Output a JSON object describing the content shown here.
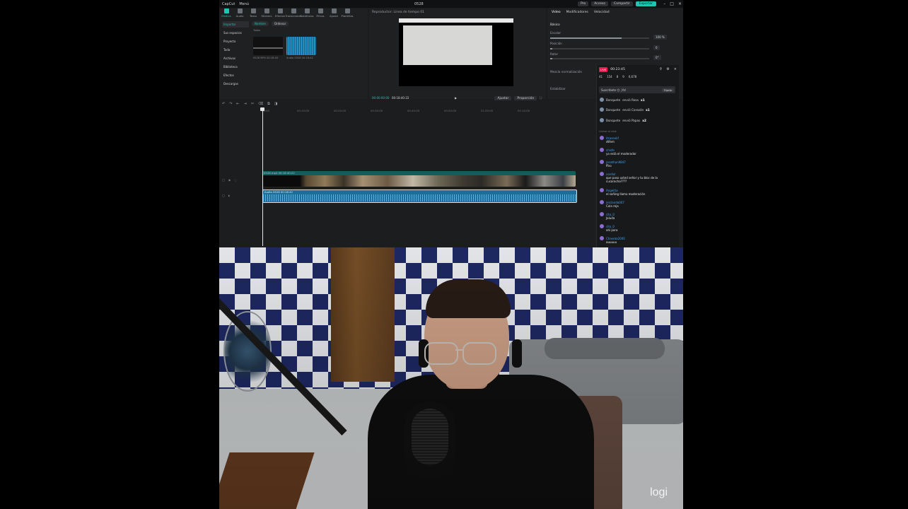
{
  "editor": {
    "menu": [
      "CapCut",
      "Menú"
    ],
    "window_title": "0528",
    "top_buttons": [
      "Pro",
      "Acceso",
      "Compartir"
    ],
    "export_label": "Exportar",
    "toolbar": [
      "Medios",
      "Audio",
      "Texto",
      "Stickers",
      "Efectos",
      "Transiciones",
      "Subtítulos",
      "Filtros",
      "Ajuste",
      "Plantillas"
    ],
    "media_sidebar": [
      "Importar",
      "Sus espacios",
      "Proyecto",
      "Toda",
      "Archivos",
      "Biblioteca",
      "Efectos",
      "Descargas"
    ],
    "media_filters": [
      "Nombre",
      "Ordenar"
    ],
    "media_label_folder": "Todos",
    "media_items": [
      {
        "caption": "0528 MP4 00:18:40"
      },
      {
        "caption": "Audio 0528 00:18:42"
      }
    ],
    "player": {
      "title": "Reproductor: Línea de tiempo 01",
      "timecode": "00:00:00:00",
      "duration": "00:18:40:22",
      "buttons": [
        "Ajustar",
        "Proporción"
      ]
    },
    "properties": {
      "tabs": [
        "Video",
        "Modificadores",
        "Velocidad"
      ],
      "section": "Básico",
      "rows": [
        {
          "label": "Escalar",
          "value": "100 %"
        },
        {
          "label": "Posición",
          "value": "0"
        },
        {
          "label": "Rotar",
          "value": "0°"
        }
      ],
      "option1": "Mezcla normalización",
      "option2": "Estabilizar"
    },
    "timeline": {
      "tools": [
        "↶",
        "↷",
        "⇤",
        "⇥",
        "✂",
        "⌫",
        "⧉",
        "◨"
      ],
      "ruler": [
        "00:00",
        "00:10:00",
        "00:20:00",
        "00:30:00",
        "00:40:00",
        "00:50:00",
        "01:00:00",
        "01:10:00"
      ],
      "video_clip_label": "0528.mp4  00:18:40:22",
      "audio_clip_label": "Audio 0528  00:18:42"
    }
  },
  "chat": {
    "live_badge": "LIVE",
    "elapsed": "00:23:45",
    "stats": [
      "41",
      "154",
      "8",
      "9",
      "6,678"
    ],
    "pinned": {
      "text": "Suscríbete 😊 ¡Ya!",
      "button": "Fijado"
    },
    "gifts": [
      {
        "user": "Bonquete",
        "text": "envió Rosa",
        "amount": "x1"
      },
      {
        "user": "Bonquete",
        "text": "envió Corazón",
        "amount": "x1"
      },
      {
        "user": "Bonquete",
        "text": "envió Papas",
        "amount": "x2"
      }
    ],
    "footer": "Unirse al chat",
    "messages": [
      {
        "user": "itsaseokf",
        "text": "dtfem"
      },
      {
        "user": "chisfe",
        "text": "ya está el moderador"
      },
      {
        "user": "jonathan9847",
        "text": "ffno"
      },
      {
        "user": "cordial",
        "text": "que paso usted señor y tu bloc de la cucaracha????"
      },
      {
        "user": "Angelita",
        "text": "el soñing llama moderación"
      },
      {
        "user": "anclanda007",
        "text": "Cola reja"
      },
      {
        "user": "cito_0",
        "text": "Jaluda"
      },
      {
        "user": "cito_0",
        "text": "ahi para"
      },
      {
        "user": "Chaveta2000",
        "text": "auuuuu"
      }
    ]
  },
  "webcam": {
    "watermark": "logi"
  },
  "colors": {
    "accent": "#1fc6b4",
    "live": "#f0164e",
    "username": "#3da2f5"
  }
}
